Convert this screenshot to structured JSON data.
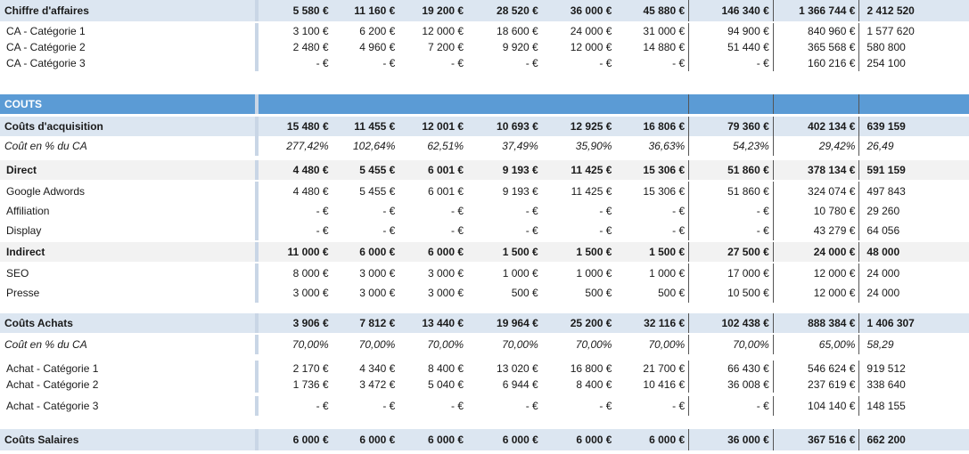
{
  "rows": [
    {
      "type": "section-hdr",
      "label": "Chiffre d'affaires",
      "values": [
        "5 580 €",
        "11 160 €",
        "19 200 €",
        "28 520 €",
        "36 000 €",
        "45 880 €",
        "146 340 €",
        "1 366 744 €",
        "2 412 520"
      ]
    },
    {
      "type": "detail",
      "label": "CA - Catégorie 1",
      "values": [
        "3 100 €",
        "6 200 €",
        "12 000 €",
        "18 600 €",
        "24 000 €",
        "31 000 €",
        "94 900 €",
        "840 960 €",
        "1 577 620"
      ]
    },
    {
      "type": "detail",
      "label": "CA - Catégorie 2",
      "values": [
        "2 480 €",
        "4 960 €",
        "7 200 €",
        "9 920 €",
        "12 000 €",
        "14 880 €",
        "51 440 €",
        "365 568 €",
        "580 800"
      ]
    },
    {
      "type": "detail",
      "label": "CA - Catégorie 3",
      "values": [
        "-   €",
        "-   €",
        "-   €",
        "-   €",
        "-   €",
        "-   €",
        "-   €",
        "160 216 €",
        "254 100"
      ]
    },
    {
      "type": "title-bar",
      "label": "COUTS",
      "values": [
        "",
        "",
        "",
        "",
        "",
        "",
        "",
        "",
        ""
      ]
    },
    {
      "type": "section-hdr",
      "label": "Coûts d'acquisition",
      "values": [
        "15 480 €",
        "11 455 €",
        "12 001 €",
        "10 693 €",
        "12 925 €",
        "16 806 €",
        "79 360 €",
        "402 134 €",
        "639 159"
      ]
    },
    {
      "type": "pct",
      "label": "Coût en % du CA",
      "values": [
        "277,42%",
        "102,64%",
        "62,51%",
        "37,49%",
        "35,90%",
        "36,63%",
        "54,23%",
        "29,42%",
        "26,49"
      ]
    },
    {
      "type": "sub-hdr",
      "label": "Direct",
      "values": [
        "4 480 €",
        "5 455 €",
        "6 001 €",
        "9 193 €",
        "11 425 €",
        "15 306 €",
        "51 860 €",
        "378 134 €",
        "591 159"
      ]
    },
    {
      "type": "detail",
      "label": "Google Adwords",
      "values": [
        "4 480 €",
        "5 455 €",
        "6 001 €",
        "9 193 €",
        "11 425 €",
        "15 306 €",
        "51 860 €",
        "324 074 €",
        "497 843"
      ]
    },
    {
      "type": "detail",
      "label": "Affiliation",
      "values": [
        "-   €",
        "-   €",
        "-   €",
        "-   €",
        "-   €",
        "-   €",
        "-   €",
        "10 780 €",
        "29 260"
      ]
    },
    {
      "type": "detail",
      "label": "Display",
      "values": [
        "-   €",
        "-   €",
        "-   €",
        "-   €",
        "-   €",
        "-   €",
        "-   €",
        "43 279 €",
        "64 056"
      ]
    },
    {
      "type": "sub-hdr",
      "label": "Indirect",
      "values": [
        "11 000 €",
        "6 000 €",
        "6 000 €",
        "1 500 €",
        "1 500 €",
        "1 500 €",
        "27 500 €",
        "24 000 €",
        "48 000"
      ]
    },
    {
      "type": "detail",
      "label": "SEO",
      "values": [
        "8 000 €",
        "3 000 €",
        "3 000 €",
        "1 000 €",
        "1 000 €",
        "1 000 €",
        "17 000 €",
        "12 000 €",
        "24 000"
      ]
    },
    {
      "type": "detail",
      "label": "Presse",
      "values": [
        "3 000 €",
        "3 000 €",
        "3 000 €",
        "500 €",
        "500 €",
        "500 €",
        "10 500 €",
        "12 000 €",
        "24 000"
      ]
    },
    {
      "type": "section-hdr",
      "label": "Coûts Achats",
      "values": [
        "3 906 €",
        "7 812 €",
        "13 440 €",
        "19 964 €",
        "25 200 €",
        "32 116 €",
        "102 438 €",
        "888 384 €",
        "1 406 307"
      ]
    },
    {
      "type": "pct",
      "label": "Coût en % du CA",
      "values": [
        "70,00%",
        "70,00%",
        "70,00%",
        "70,00%",
        "70,00%",
        "70,00%",
        "70,00%",
        "65,00%",
        "58,29"
      ]
    },
    {
      "type": "detail",
      "label": "Achat - Catégorie 1",
      "values": [
        "2 170 €",
        "4 340 €",
        "8 400 €",
        "13 020 €",
        "16 800 €",
        "21 700 €",
        "66 430 €",
        "546 624 €",
        "919 512"
      ]
    },
    {
      "type": "detail",
      "label": "Achat - Catégorie 2",
      "values": [
        "1 736 €",
        "3 472 €",
        "5 040 €",
        "6 944 €",
        "8 400 €",
        "10 416 €",
        "36 008 €",
        "237 619 €",
        "338 640"
      ]
    },
    {
      "type": "detail",
      "label": "Achat - Catégorie 3",
      "values": [
        "-   €",
        "-   €",
        "-   €",
        "-   €",
        "-   €",
        "-   €",
        "-   €",
        "104 140 €",
        "148 155"
      ]
    },
    {
      "type": "section-hdr",
      "label": "Coûts Salaires",
      "values": [
        "6 000 €",
        "6 000 €",
        "6 000 €",
        "6 000 €",
        "6 000 €",
        "6 000 €",
        "36 000 €",
        "367 516 €",
        "662 200"
      ]
    }
  ]
}
